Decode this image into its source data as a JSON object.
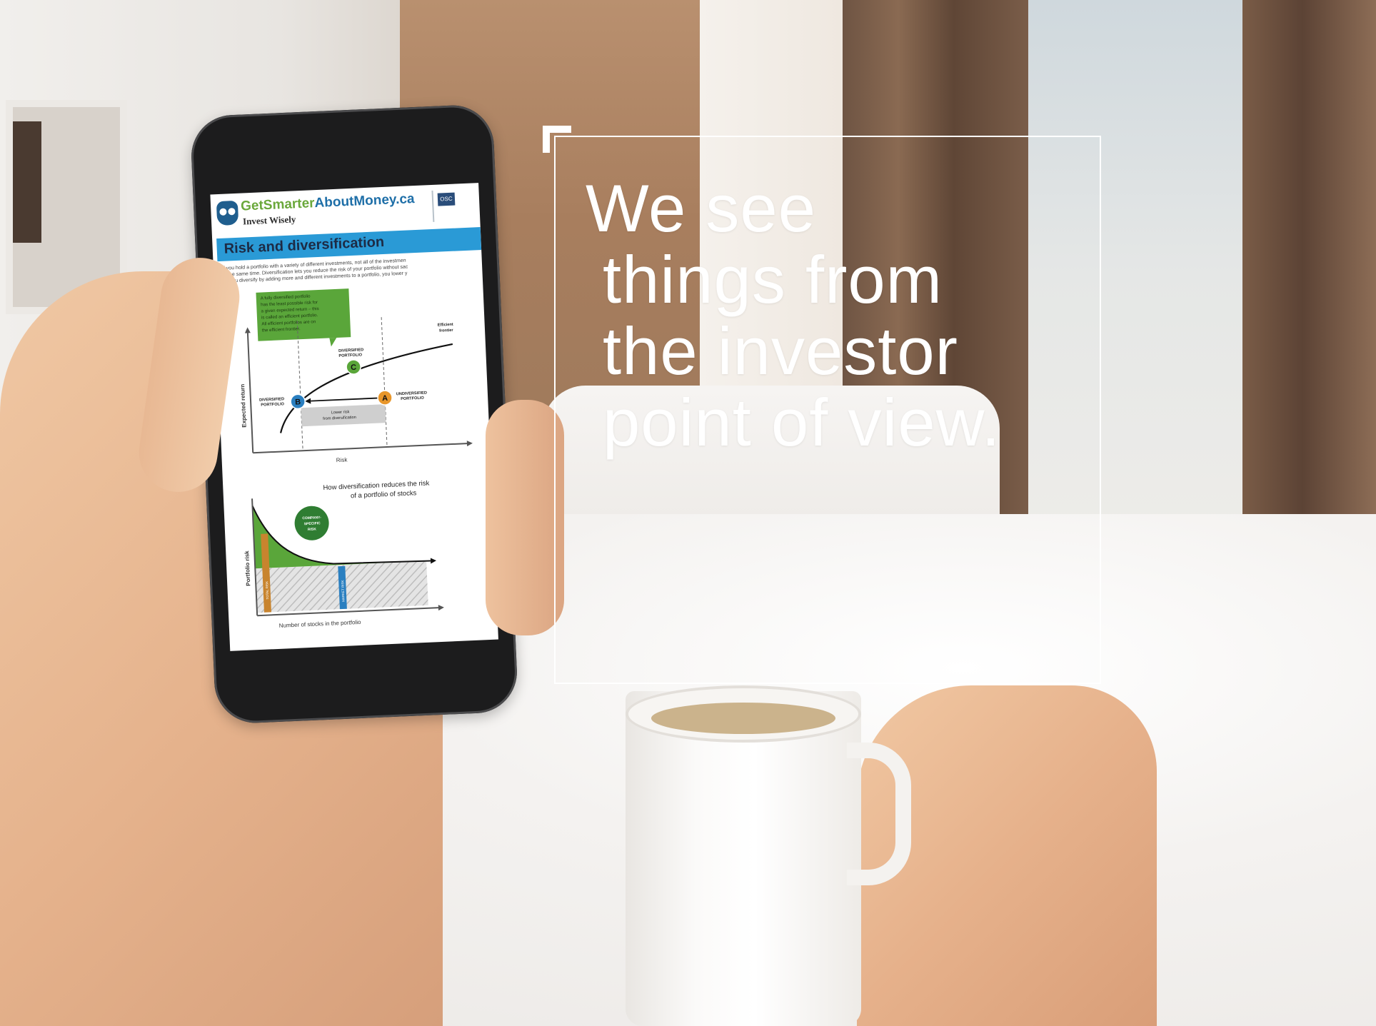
{
  "overlay": {
    "headline_lines": [
      "We see",
      "things from",
      "the investor",
      "point of view."
    ]
  },
  "phone_screen": {
    "brand_part1": "GetSmarter",
    "brand_part2": "AboutMoney.ca",
    "tagline": "Invest Wisely",
    "osc_badge": "OSC",
    "page_title": "Risk and diversification",
    "intro_lines": [
      "If you hold a portfolio with a variety of different investments, not all of the investmen",
      "at the same time. Diversification lets you reduce the risk of your portfolio without sac",
      "As you diversify by adding more and different investments to a portfolio, you lower y"
    ],
    "chart1": {
      "callout": [
        "A fully diversified portfolio",
        "has the least possible risk for",
        "a given expected return – this",
        "is called an efficient portfolio.",
        "All efficient portfolios are on",
        "the efficient frontier."
      ],
      "efficient_frontier_label": [
        "Efficient",
        "frontier"
      ],
      "point_c_label": [
        "DIVERSIFIED",
        "PORTFOLIO"
      ],
      "point_b_label": [
        "DIVERSIFIED",
        "PORTFOLIO"
      ],
      "point_a_label": [
        "UNDIVERSIFIED",
        "PORTFOLIO"
      ],
      "arrow_label": [
        "Lower risk",
        "from diversification"
      ],
      "point_a": "A",
      "point_b": "B",
      "point_c": "C",
      "y_axis": "Expected return",
      "x_axis": "Risk"
    },
    "chart2": {
      "title_lines": [
        "How diversification reduces the risk",
        "of a portfolio of stocks"
      ],
      "bubble": [
        "COMPANY-",
        "SPECIFIC",
        "RISK"
      ],
      "y_axis": "Portfolio risk",
      "x_axis": "Number of stocks in the portfolio",
      "total_risk": "TOTAL RISK",
      "market_risk": "MARKET RISK"
    }
  },
  "colors": {
    "brand_green": "#6aa83b",
    "brand_blue": "#1f6fa8",
    "title_bar": "#2a9ad6",
    "chart_green": "#5aa63a",
    "point_blue": "#2a7fc0",
    "point_orange": "#e8962a",
    "overlay_text": "#ffffff"
  }
}
